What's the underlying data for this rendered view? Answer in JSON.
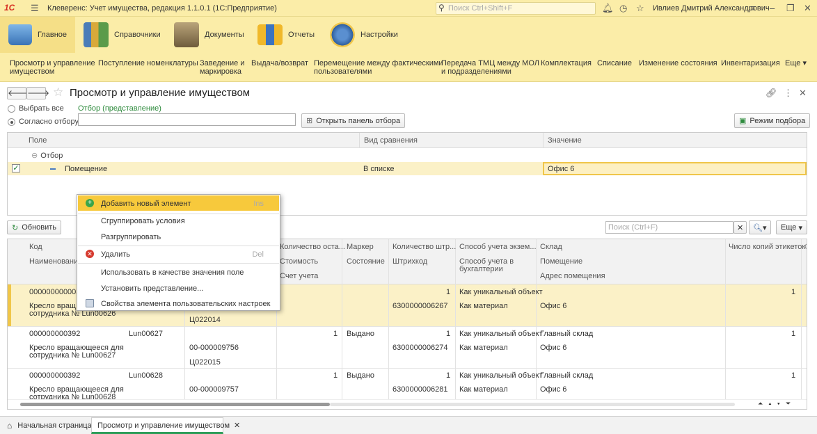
{
  "app": {
    "logo": "1С",
    "title": "Клеверенс: Учет имущества, редакция 1.1.0.1  (1С:Предприятие)",
    "search_placeholder": "Поиск Ctrl+Shift+F",
    "user": "Ивлиев Дмитрий Александрович"
  },
  "sections": [
    {
      "label": "Главное"
    },
    {
      "label": "Справочники"
    },
    {
      "label": "Документы"
    },
    {
      "label": "Отчеты"
    },
    {
      "label": "Настройки"
    }
  ],
  "functions": [
    {
      "line1": "Просмотр и управление",
      "line2": "имуществом"
    },
    {
      "line1": "Поступление номенклатуры",
      "line2": ""
    },
    {
      "line1": "Заведение и",
      "line2": "маркировка"
    },
    {
      "line1": "Выдача/возврат",
      "line2": ""
    },
    {
      "line1": "Перемещение между фактическими",
      "line2": "пользователями"
    },
    {
      "line1": "Передача ТМЦ между МОЛ",
      "line2": "и подразделениями"
    },
    {
      "line1": "Комплектация",
      "line2": ""
    },
    {
      "line1": "Списание",
      "line2": ""
    },
    {
      "line1": "Изменение состояния",
      "line2": ""
    },
    {
      "line1": "Инвентаризация",
      "line2": ""
    },
    {
      "line1": "Еще",
      "line2": ""
    }
  ],
  "form": {
    "title": "Просмотр и управление имуществом",
    "select_all": "Выбрать все",
    "by_filter": "Согласно отбору:",
    "filter_link": "Отбор (представление)",
    "open_filter_btn": "Открыть панель отбора",
    "pick_mode_btn": "Режим подбора",
    "refresh_btn": "Обновить",
    "search_placeholder": "Поиск (Ctrl+F)",
    "more_btn": "Еще"
  },
  "settings": {
    "columns": [
      "Поле",
      "Вид сравнения",
      "Значение"
    ],
    "group": "Отбор",
    "row": {
      "field": "Помещение",
      "compare": "В списке",
      "value": "Офис 6"
    }
  },
  "context_menu": [
    {
      "label": "Добавить новый элемент",
      "shortcut": "Ins",
      "icon": "add-circle-icon",
      "highlight": true
    },
    {
      "label": "Сгруппировать условия",
      "shortcut": "",
      "icon": ""
    },
    {
      "label": "Разгруппировать",
      "shortcut": "",
      "icon": ""
    },
    {
      "label": "Удалить",
      "shortcut": "Del",
      "icon": "delete-icon"
    },
    {
      "label": "Использовать в качестве значения поле",
      "shortcut": "",
      "icon": ""
    },
    {
      "label": "Установить представление...",
      "shortcut": "",
      "icon": ""
    },
    {
      "label": "Свойства элемента пользовательских настроек",
      "shortcut": "",
      "icon": "properties-icon"
    }
  ],
  "grid": {
    "headers": {
      "code": "Код",
      "name": "Наименование",
      "qty_rest": "Количество оста...",
      "cost": "Стоимость",
      "account": "Счет учета",
      "marker": "Маркер",
      "state": "Состояние",
      "qty_pcs": "Количество штр...",
      "barcode": "Штрихкод",
      "copy_method": "Способ учета экзем...",
      "acc_method": "Способ учета в",
      "acc_method2": "бухгалтерии",
      "warehouse": "Склад",
      "room": "Помещение",
      "address": "Адрес помещения",
      "labels": "Число копий этикеток"
    },
    "rows": [
      {
        "code": "000000000003",
        "name1": "Кресло вращ",
        "name2": "сотрудника № Lun00626",
        "inv": "",
        "qty": "",
        "cost": "",
        "account": "Ц022014",
        "marker": "",
        "qtypcs": "1",
        "barcode": "6300000006267",
        "copy": "Как уникальный объект",
        "accm": "Как материал",
        "warehouse": "",
        "room": "Офис 6",
        "labels": "1"
      },
      {
        "code": "000000000392",
        "name1": "Кресло вращающееся для",
        "name2": "сотрудника № Lun00627",
        "inv": "Lun00627",
        "qty": "1",
        "cost": "00-000009756",
        "account": "Ц022015",
        "marker": "Выдано",
        "qtypcs": "1",
        "barcode": "6300000006274",
        "copy": "Как уникальный объект",
        "accm": "Как материал",
        "warehouse": "Главный склад",
        "room": "Офис 6",
        "labels": "1"
      },
      {
        "code": "000000000392",
        "name1": "Кресло вращающееся для",
        "name2": "сотрудника № Lun00628",
        "inv": "Lun00628",
        "qty": "1",
        "cost": "00-000009757",
        "account": "",
        "marker": "Выдано",
        "qtypcs": "1",
        "barcode": "6300000006281",
        "copy": "Как уникальный объект",
        "accm": "Как материал",
        "warehouse": "Главный склад",
        "room": "Офис 6",
        "labels": "1"
      }
    ]
  },
  "footer": {
    "home_tab": "Начальная страница",
    "active_tab": "Просмотр и управление имуществом"
  }
}
